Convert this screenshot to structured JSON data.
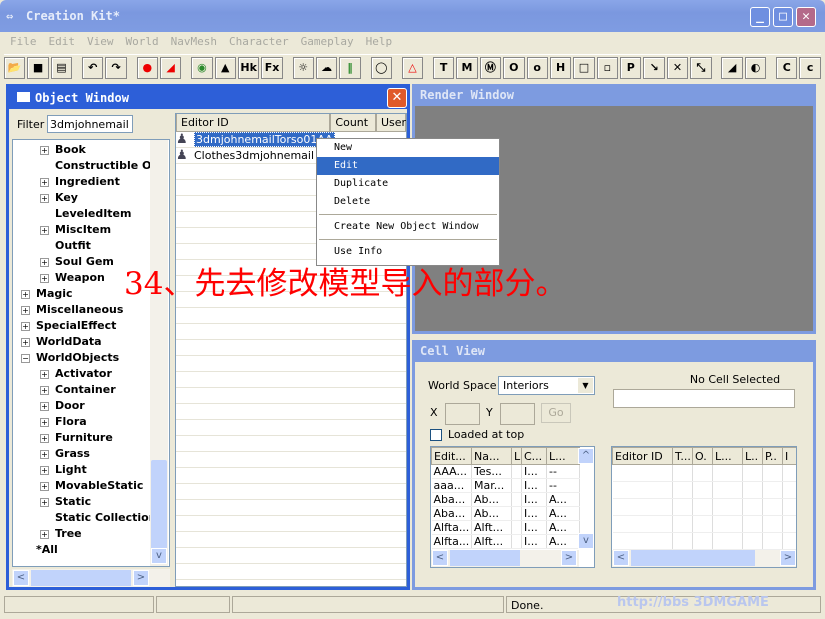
{
  "app": {
    "title": "Creation Kit*"
  },
  "menu": [
    "File",
    "Edit",
    "View",
    "World",
    "NavMesh",
    "Character",
    "Gameplay",
    "Help"
  ],
  "toolbar": {
    "icons": [
      "open-icon",
      "save-icon",
      "properties-icon",
      "undo-icon",
      "redo-icon",
      "grid-icon",
      "angle-icon",
      "globe-icon",
      "landscape-icon",
      "havok-icon",
      "fx-icon",
      "light-bulb-icon",
      "sky-icon",
      "grass-icon",
      "speech-bubble-icon",
      "navmesh-icon",
      "T",
      "M",
      "Ⓜ",
      "O",
      "o",
      "H",
      "□",
      "▫",
      "P",
      "↘",
      "✕",
      "⤡",
      "◢",
      "◐",
      "C",
      "c"
    ]
  },
  "object_window": {
    "title": "Object Window",
    "filter_label": "Filter",
    "filter_value": "3dmjohnemail",
    "tree": [
      {
        "label": "Book",
        "level": 2,
        "plus": true
      },
      {
        "label": "Constructible Ob",
        "level": 2,
        "plus": false
      },
      {
        "label": "Ingredient",
        "level": 2,
        "plus": true
      },
      {
        "label": "Key",
        "level": 2,
        "plus": true
      },
      {
        "label": "LeveledItem",
        "level": 2,
        "plus": false
      },
      {
        "label": "MiscItem",
        "level": 2,
        "plus": true
      },
      {
        "label": "Outfit",
        "level": 2,
        "plus": false
      },
      {
        "label": "Soul Gem",
        "level": 2,
        "plus": true
      },
      {
        "label": "Weapon",
        "level": 2,
        "plus": true
      },
      {
        "label": "Magic",
        "level": 1,
        "plus": true
      },
      {
        "label": "Miscellaneous",
        "level": 1,
        "plus": true
      },
      {
        "label": "SpecialEffect",
        "level": 1,
        "plus": true
      },
      {
        "label": "WorldData",
        "level": 1,
        "plus": true
      },
      {
        "label": "WorldObjects",
        "level": 1,
        "plus": "minus"
      },
      {
        "label": "Activator",
        "level": 2,
        "plus": true
      },
      {
        "label": "Container",
        "level": 2,
        "plus": true
      },
      {
        "label": "Door",
        "level": 2,
        "plus": true
      },
      {
        "label": "Flora",
        "level": 2,
        "plus": true
      },
      {
        "label": "Furniture",
        "level": 2,
        "plus": true
      },
      {
        "label": "Grass",
        "level": 2,
        "plus": true
      },
      {
        "label": "Light",
        "level": 2,
        "plus": true
      },
      {
        "label": "MovableStatic",
        "level": 2,
        "plus": true
      },
      {
        "label": "Static",
        "level": 2,
        "plus": true
      },
      {
        "label": "Static Collection",
        "level": 2,
        "plus": false
      },
      {
        "label": "Tree",
        "level": 2,
        "plus": true
      },
      {
        "label": "*All",
        "level": 1,
        "plus": false
      }
    ],
    "columns": [
      "Editor ID",
      "Count",
      "User"
    ],
    "rows": [
      "3dmjohnemailTorso01AA",
      "Clothes3dmjohnemail"
    ]
  },
  "context_menu": {
    "items": [
      "New",
      "Edit",
      "Duplicate",
      "Delete",
      "Create New Object Window",
      "Use Info"
    ],
    "highlighted": "Edit"
  },
  "annotation": "34、先去修改模型导入的部分。",
  "render_window": {
    "title": "Render Window"
  },
  "cell_view": {
    "title": "Cell View",
    "world_space_label": "World Space",
    "world_space_value": "Interiors",
    "no_cell": "No Cell Selected",
    "x_label": "X",
    "y_label": "Y",
    "go": "Go",
    "loaded_at_top": "Loaded at top",
    "left_columns": [
      "Edit...",
      "Na...",
      "L",
      "C...",
      "L..."
    ],
    "left_rows": [
      [
        "AAA...",
        "Tes...",
        "",
        "I...",
        "--"
      ],
      [
        "aaa...",
        "Mar...",
        "",
        "I...",
        "--"
      ],
      [
        "Aba...",
        "Ab...",
        "",
        "I...",
        "A..."
      ],
      [
        "Aba...",
        "Ab...",
        "",
        "I...",
        "A..."
      ],
      [
        "Alfta...",
        "Alft...",
        "",
        "I...",
        "A..."
      ],
      [
        "Alfta...",
        "Alft...",
        "",
        "I...",
        "A..."
      ]
    ],
    "right_columns": [
      "Editor ID",
      "T...",
      "O.",
      "L...",
      "L..",
      "P..",
      "I"
    ]
  },
  "status": {
    "text": "Done.",
    "watermark": "http://bbs 3DMGAME"
  },
  "colors": {
    "accent": "#2d5fd8",
    "selection": "#316ac5",
    "annotation": "#ff0000"
  }
}
